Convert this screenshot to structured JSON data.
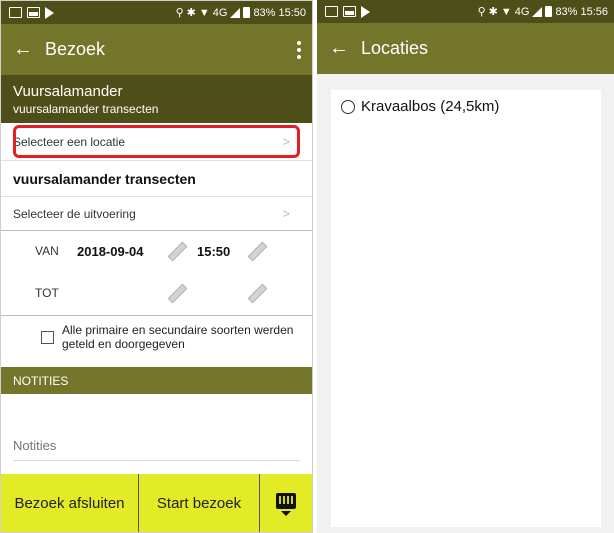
{
  "left": {
    "status": {
      "time": "15:50",
      "battery": "83%",
      "network": "4G"
    },
    "appbar": {
      "back": "←",
      "title": "Bezoek"
    },
    "header": {
      "title": "Vuursalamander",
      "subtitle": "vuursalamander transecten"
    },
    "select_location": {
      "label": "Selecteer een locatie",
      "chevron": ">"
    },
    "project": {
      "label": "vuursalamander transecten"
    },
    "select_execution": {
      "label": "Selecteer de uitvoering",
      "chevron": ">"
    },
    "van": {
      "label": "VAN",
      "date": "2018-09-04",
      "time": "15:50"
    },
    "tot": {
      "label": "TOT",
      "date": "",
      "time": ""
    },
    "checkbox": {
      "label": "Alle primaire en secundaire soorten werden geteld en doorgegeven",
      "checked": false
    },
    "notes": {
      "section_title": "NOTITIES",
      "placeholder": "Notities",
      "value": ""
    },
    "buttons": {
      "close_visit": "Bezoek afsluiten",
      "start_visit": "Start bezoek"
    }
  },
  "right": {
    "status": {
      "time": "15:56",
      "battery": "83%",
      "network": "4G"
    },
    "appbar": {
      "back": "←",
      "title": "Locaties"
    },
    "locations": [
      {
        "label": "Kravaalbos (24,5km)",
        "selected": false
      }
    ]
  },
  "colors": {
    "statusbar": "#4e4f18",
    "appbar": "#73762a",
    "button": "#e3ea26",
    "highlight": "#e51d24"
  },
  "icons": {
    "back": "arrow-left-icon",
    "more": "more-vertical-icon",
    "edit": "pencil-icon",
    "keyboard": "keyboard-icon",
    "chevron": "chevron-right-icon"
  }
}
